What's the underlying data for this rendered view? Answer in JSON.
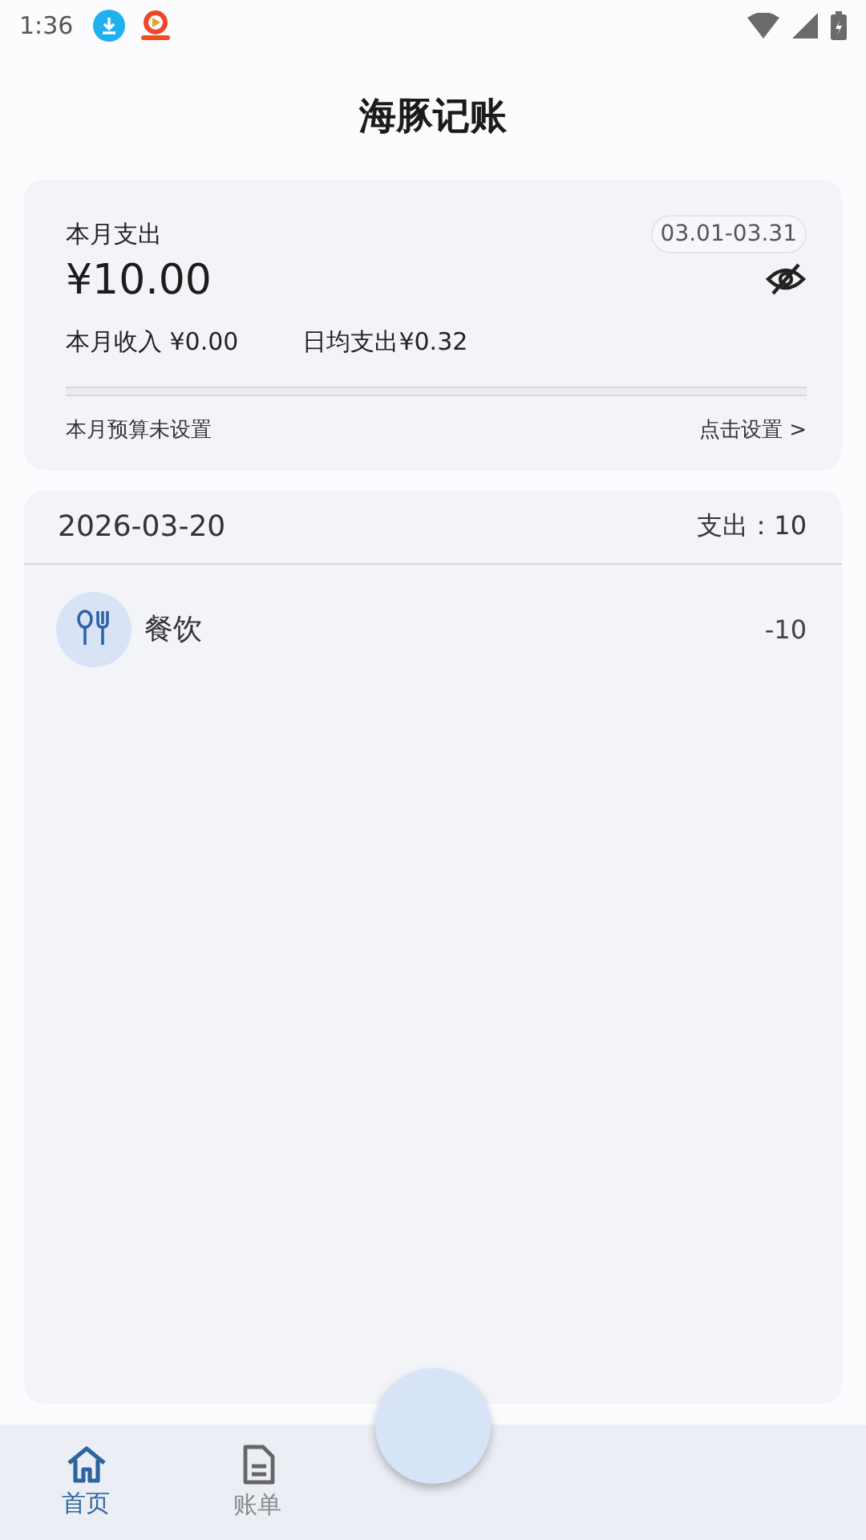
{
  "status_bar": {
    "time": "1:36"
  },
  "header": {
    "title": "海豚记账"
  },
  "summary": {
    "label": "本月支出",
    "range": "03.01-03.31",
    "amount": "¥10.00",
    "income": "本月收入 ¥0.00",
    "daily": "日均支出¥0.32",
    "budget": "本月预算未设置",
    "budget_action": "点击设置 >"
  },
  "day": {
    "date": "2026-03-20",
    "total_label": "支出：",
    "total": "10",
    "entries": [
      {
        "category": "餐饮",
        "amount": "-10"
      }
    ]
  },
  "tabs": [
    {
      "label": "首页",
      "selected": true
    },
    {
      "label": "账单",
      "selected": false
    }
  ]
}
